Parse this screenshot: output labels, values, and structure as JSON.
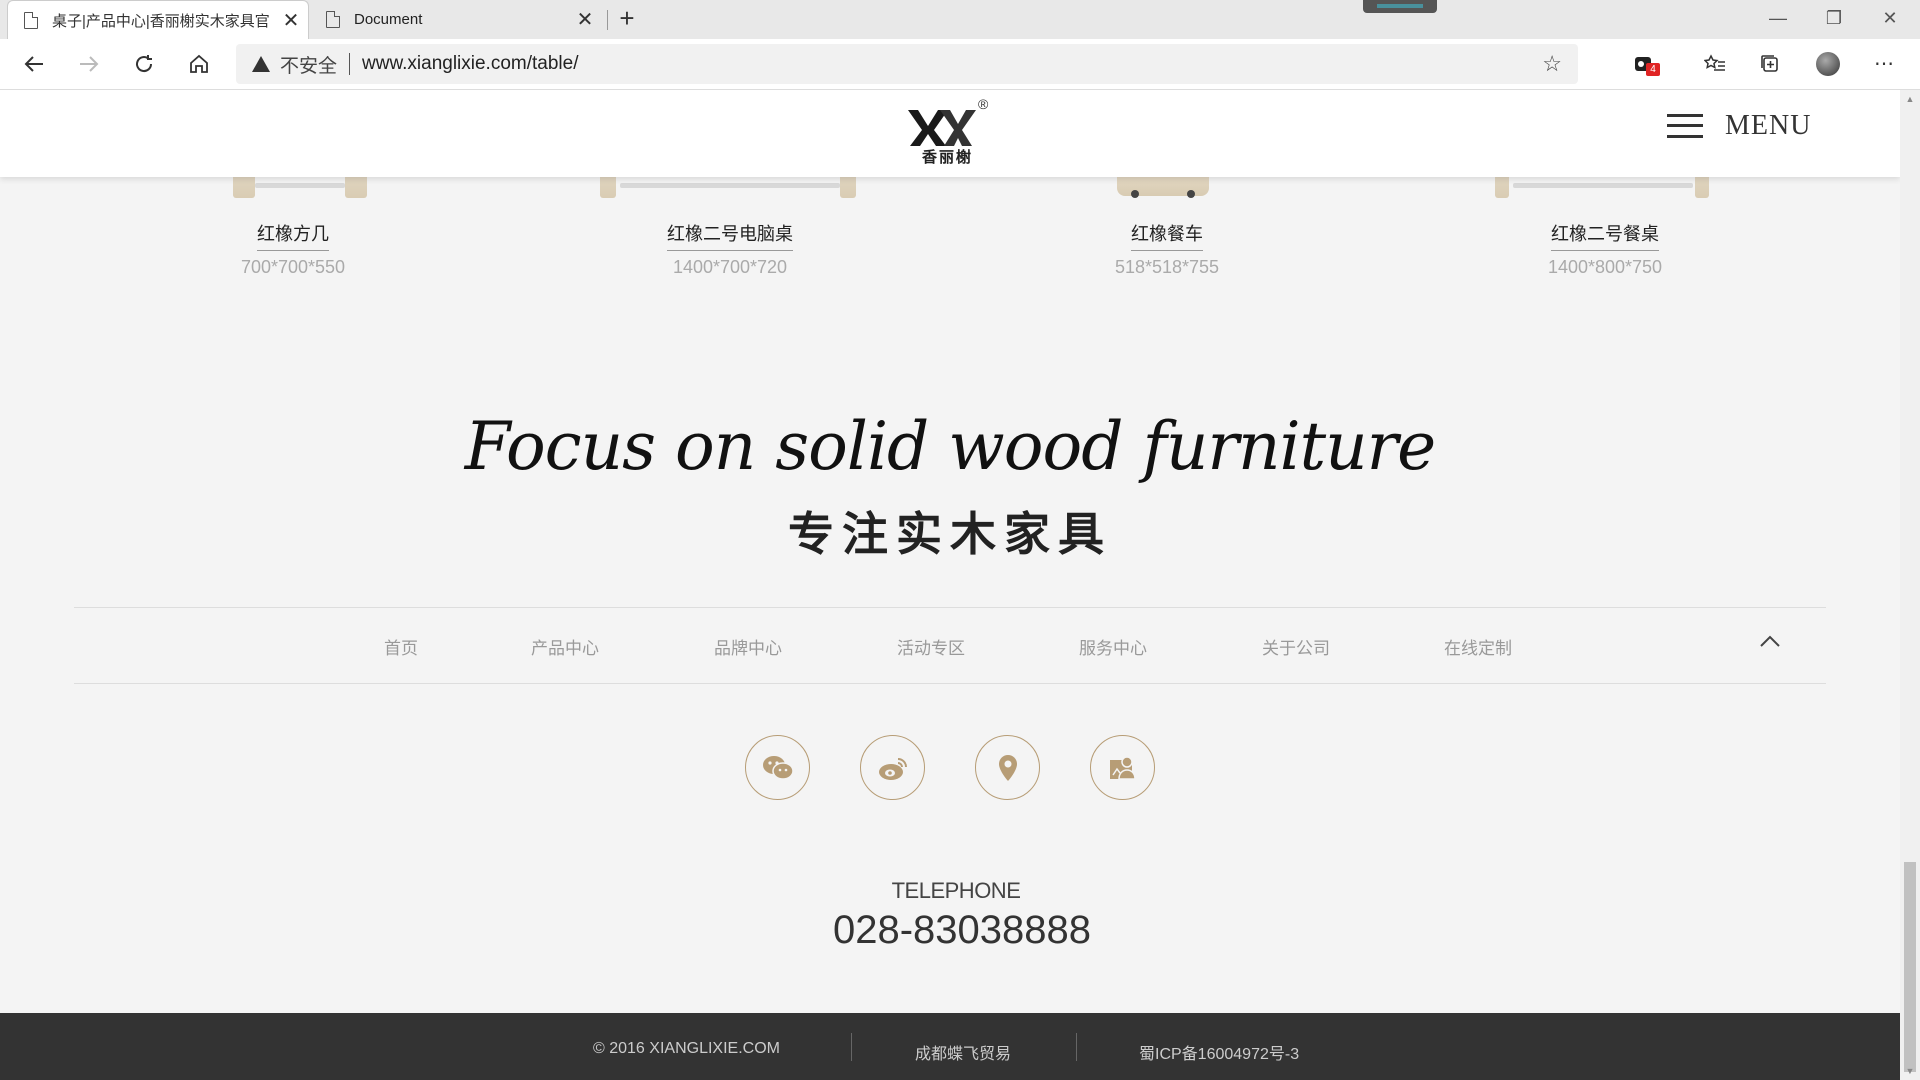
{
  "browser": {
    "tabs": [
      {
        "title": "桌子|产品中心|香丽榭实木家具官",
        "active": true
      },
      {
        "title": "Document",
        "active": false
      }
    ],
    "new_tab": "+",
    "close_glyph": "✕",
    "address": {
      "security_label": "不安全",
      "url": "www.xianglixie.com/table/"
    },
    "extension_badge": "4",
    "window_controls": [
      "—",
      "❐",
      "✕"
    ]
  },
  "header": {
    "logo_cn": "香丽榭",
    "logo_reg": "®",
    "menu_label": "MENU"
  },
  "products": [
    {
      "name": "红橡方几",
      "size": "700*700*550"
    },
    {
      "name": "红橡二号电脑桌",
      "size": "1400*700*720"
    },
    {
      "name": "红橡餐车",
      "size": "518*518*755"
    },
    {
      "name": "红橡二号餐桌",
      "size": "1400*800*750"
    }
  ],
  "slogan": {
    "en": "Focus on solid wood furniture",
    "cn": "专注实木家具"
  },
  "footer_nav": [
    "首页",
    "产品中心",
    "品牌中心",
    "活动专区",
    "服务中心",
    "关于公司",
    "在线定制"
  ],
  "social_icons": [
    "wechat-icon",
    "weibo-icon",
    "location-icon",
    "contact-card-icon"
  ],
  "contact": {
    "label": "TELEPHONE",
    "phone": "028-83038888"
  },
  "copyright": {
    "text": "© 2016 XIANGLIXIE.COM",
    "company": "成都蝶飞贸易",
    "icp": "蜀ICP备16004972号-3"
  },
  "colors": {
    "accent": "#b79d76",
    "footer_bg": "#333333",
    "page_bg": "#f4f4f4"
  }
}
